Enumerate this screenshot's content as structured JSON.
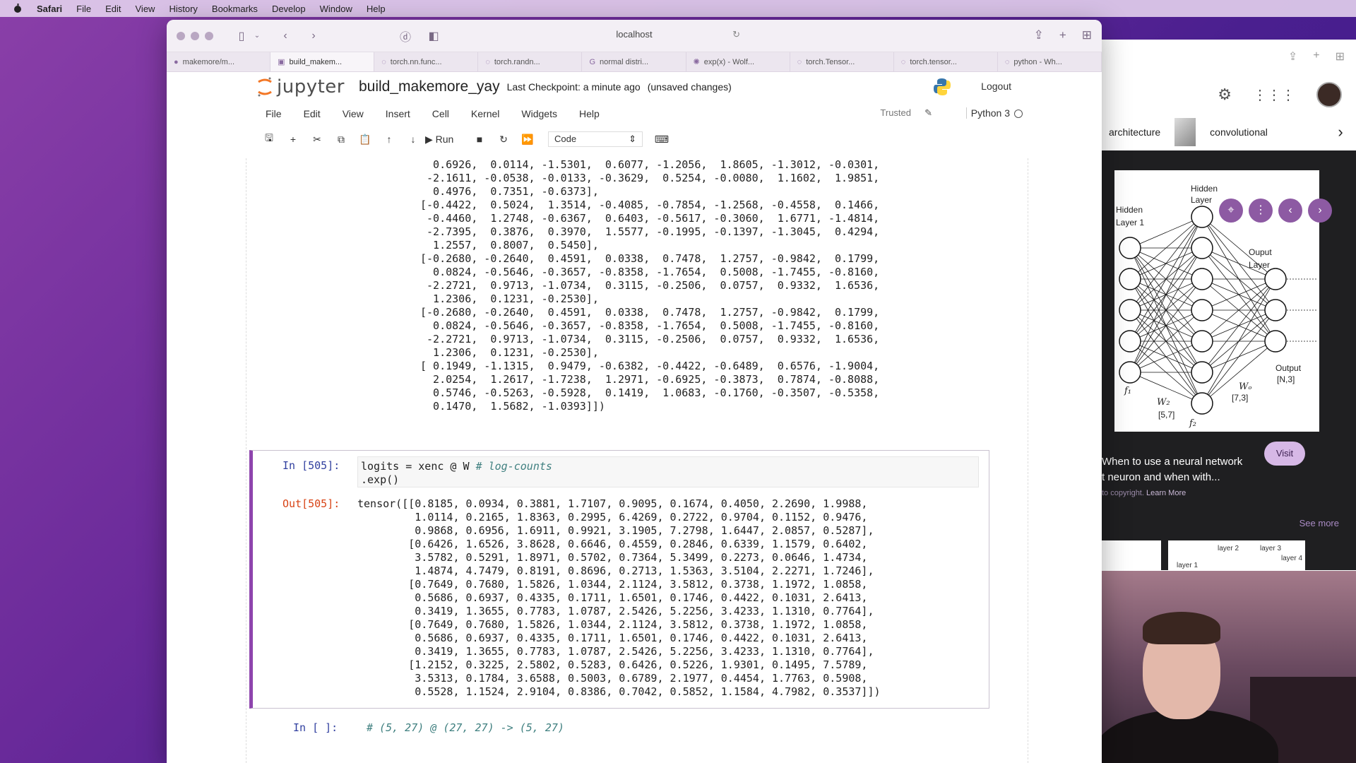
{
  "menubar": {
    "app": "Safari",
    "items": [
      "File",
      "Edit",
      "View",
      "History",
      "Bookmarks",
      "Develop",
      "Window",
      "Help"
    ]
  },
  "safari": {
    "address": "localhost",
    "tabs": [
      {
        "label": "makemore/m..."
      },
      {
        "label": "build_makem..."
      },
      {
        "label": "torch.nn.func..."
      },
      {
        "label": "torch.randn..."
      },
      {
        "label": "normal distri..."
      },
      {
        "label": "exp(x) - Wolf..."
      },
      {
        "label": "torch.Tensor..."
      },
      {
        "label": "torch.tensor..."
      },
      {
        "label": "python - Wh..."
      }
    ]
  },
  "jupyter": {
    "brand": "jupyter",
    "notebook_name": "build_makemore_yay",
    "checkpoint": "Last Checkpoint: a minute ago",
    "unsaved": "(unsaved changes)",
    "logout": "Logout",
    "menu": [
      "File",
      "Edit",
      "View",
      "Insert",
      "Cell",
      "Kernel",
      "Widgets",
      "Help"
    ],
    "trusted": "Trusted",
    "kernel": "Python 3",
    "run_label": "Run",
    "cell_type": "Code"
  },
  "notebook": {
    "prev_output": "  0.6926,  0.0114, -1.5301,  0.6077, -1.2056,  1.8605, -1.3012, -0.0301,\n -2.1611, -0.0538, -0.0133, -0.3629,  0.5254, -0.0080,  1.1602,  1.9851,\n  0.4976,  0.7351, -0.6373],\n[-0.4422,  0.5024,  1.3514, -0.4085, -0.7854, -1.2568, -0.4558,  0.1466,\n -0.4460,  1.2748, -0.6367,  0.6403, -0.5617, -0.3060,  1.6771, -1.4814,\n -2.7395,  0.3876,  0.3970,  1.5577, -0.1995, -0.1397, -1.3045,  0.4294,\n  1.2557,  0.8007,  0.5450],\n[-0.2680, -0.2640,  0.4591,  0.0338,  0.7478,  1.2757, -0.9842,  0.1799,\n  0.0824, -0.5646, -0.3657, -0.8358, -1.7654,  0.5008, -1.7455, -0.8160,\n -2.2721,  0.9713, -1.0734,  0.3115, -0.2506,  0.0757,  0.9332,  1.6536,\n  1.2306,  0.1231, -0.2530],\n[-0.2680, -0.2640,  0.4591,  0.0338,  0.7478,  1.2757, -0.9842,  0.1799,\n  0.0824, -0.5646, -0.3657, -0.8358, -1.7654,  0.5008, -1.7455, -0.8160,\n -2.2721,  0.9713, -1.0734,  0.3115, -0.2506,  0.0757,  0.9332,  1.6536,\n  1.2306,  0.1231, -0.2530],\n[ 0.1949, -1.1315,  0.9479, -0.6382, -0.4422, -0.6489,  0.6576, -1.9004,\n  2.0254,  1.2617, -1.7238,  1.2971, -0.6925, -0.3873,  0.7874, -0.8088,\n  0.5746, -0.5263, -0.5928,  0.1419,  1.0683, -0.1760, -0.3507, -0.5358,\n  0.1470,  1.5682, -1.0393]])",
    "cell_in_prompt": "In [505]:",
    "cell_code_main": "logits = xenc @ W ",
    "cell_code_comment": "# log-counts",
    "cell_code_line2": ".exp()",
    "cell_out_prompt": "Out[505]:",
    "cell_output": "tensor([[0.8185, 0.0934, 0.3881, 1.7107, 0.9095, 0.1674, 0.4050, 2.2690, 1.9988,\n         1.0114, 0.2165, 1.8363, 0.2995, 6.4269, 0.2722, 0.9704, 0.1152, 0.9476,\n         0.9868, 0.6956, 1.6911, 0.9921, 3.1905, 7.2798, 1.6447, 2.0857, 0.5287],\n        [0.6426, 1.6526, 3.8628, 0.6646, 0.4559, 0.2846, 0.6339, 1.1579, 0.6402,\n         3.5782, 0.5291, 1.8971, 0.5702, 0.7364, 5.3499, 0.2273, 0.0646, 1.4734,\n         1.4874, 4.7479, 0.8191, 0.8696, 0.2713, 1.5363, 3.5104, 2.2271, 1.7246],\n        [0.7649, 0.7680, 1.5826, 1.0344, 2.1124, 3.5812, 0.3738, 1.1972, 1.0858,\n         0.5686, 0.6937, 0.4335, 0.1711, 1.6501, 0.1746, 0.4422, 0.1031, 2.6413,\n         0.3419, 1.3655, 0.7783, 1.0787, 2.5426, 5.2256, 3.4233, 1.1310, 0.7764],\n        [0.7649, 0.7680, 1.5826, 1.0344, 2.1124, 3.5812, 0.3738, 1.1972, 1.0858,\n         0.5686, 0.6937, 0.4335, 0.1711, 1.6501, 0.1746, 0.4422, 0.1031, 2.6413,\n         0.3419, 1.3655, 0.7783, 1.0787, 2.5426, 5.2256, 3.4233, 1.1310, 0.7764],\n        [1.2152, 0.3225, 2.5802, 0.5283, 0.6426, 0.5226, 1.9301, 0.1495, 7.5789,\n         3.5313, 0.1784, 3.6588, 0.5003, 0.6789, 2.1977, 0.4454, 1.7763, 0.5908,\n         0.5528, 1.1524, 2.9104, 0.8386, 0.7042, 0.5852, 1.1584, 4.7982, 0.3537]])",
    "next_in_prompt": "In [ ]:",
    "next_code": "# (5, 27) @ (27, 27) -> (5, 27)"
  },
  "right_panel": {
    "chips": [
      "architecture",
      "convolutional"
    ],
    "caption": "When to use a neural network\nt neuron and when with...",
    "copyright_prefix": "to copyright.",
    "learn_more": "Learn More",
    "visit": "Visit",
    "see_more": "See more",
    "diagram_labels": {
      "hidden1": "Hidden\nLayer 1",
      "hidden2": "Hidden\nLayer",
      "output_layer": "Ouput\nLayer",
      "output": "Output\n[N,3]",
      "w2": "W2\n[5,7]",
      "wo": "Wo\n[7,3]",
      "f1": "f1",
      "f2": "f2"
    },
    "thumb_labels": [
      "layer 1",
      "layer 2",
      "layer 3",
      "layer 4"
    ]
  },
  "colors": {
    "accent": "#8e44ad",
    "jupyter_orange": "#f37726",
    "in_prompt": "#303f9f",
    "out_prompt": "#d84315"
  }
}
